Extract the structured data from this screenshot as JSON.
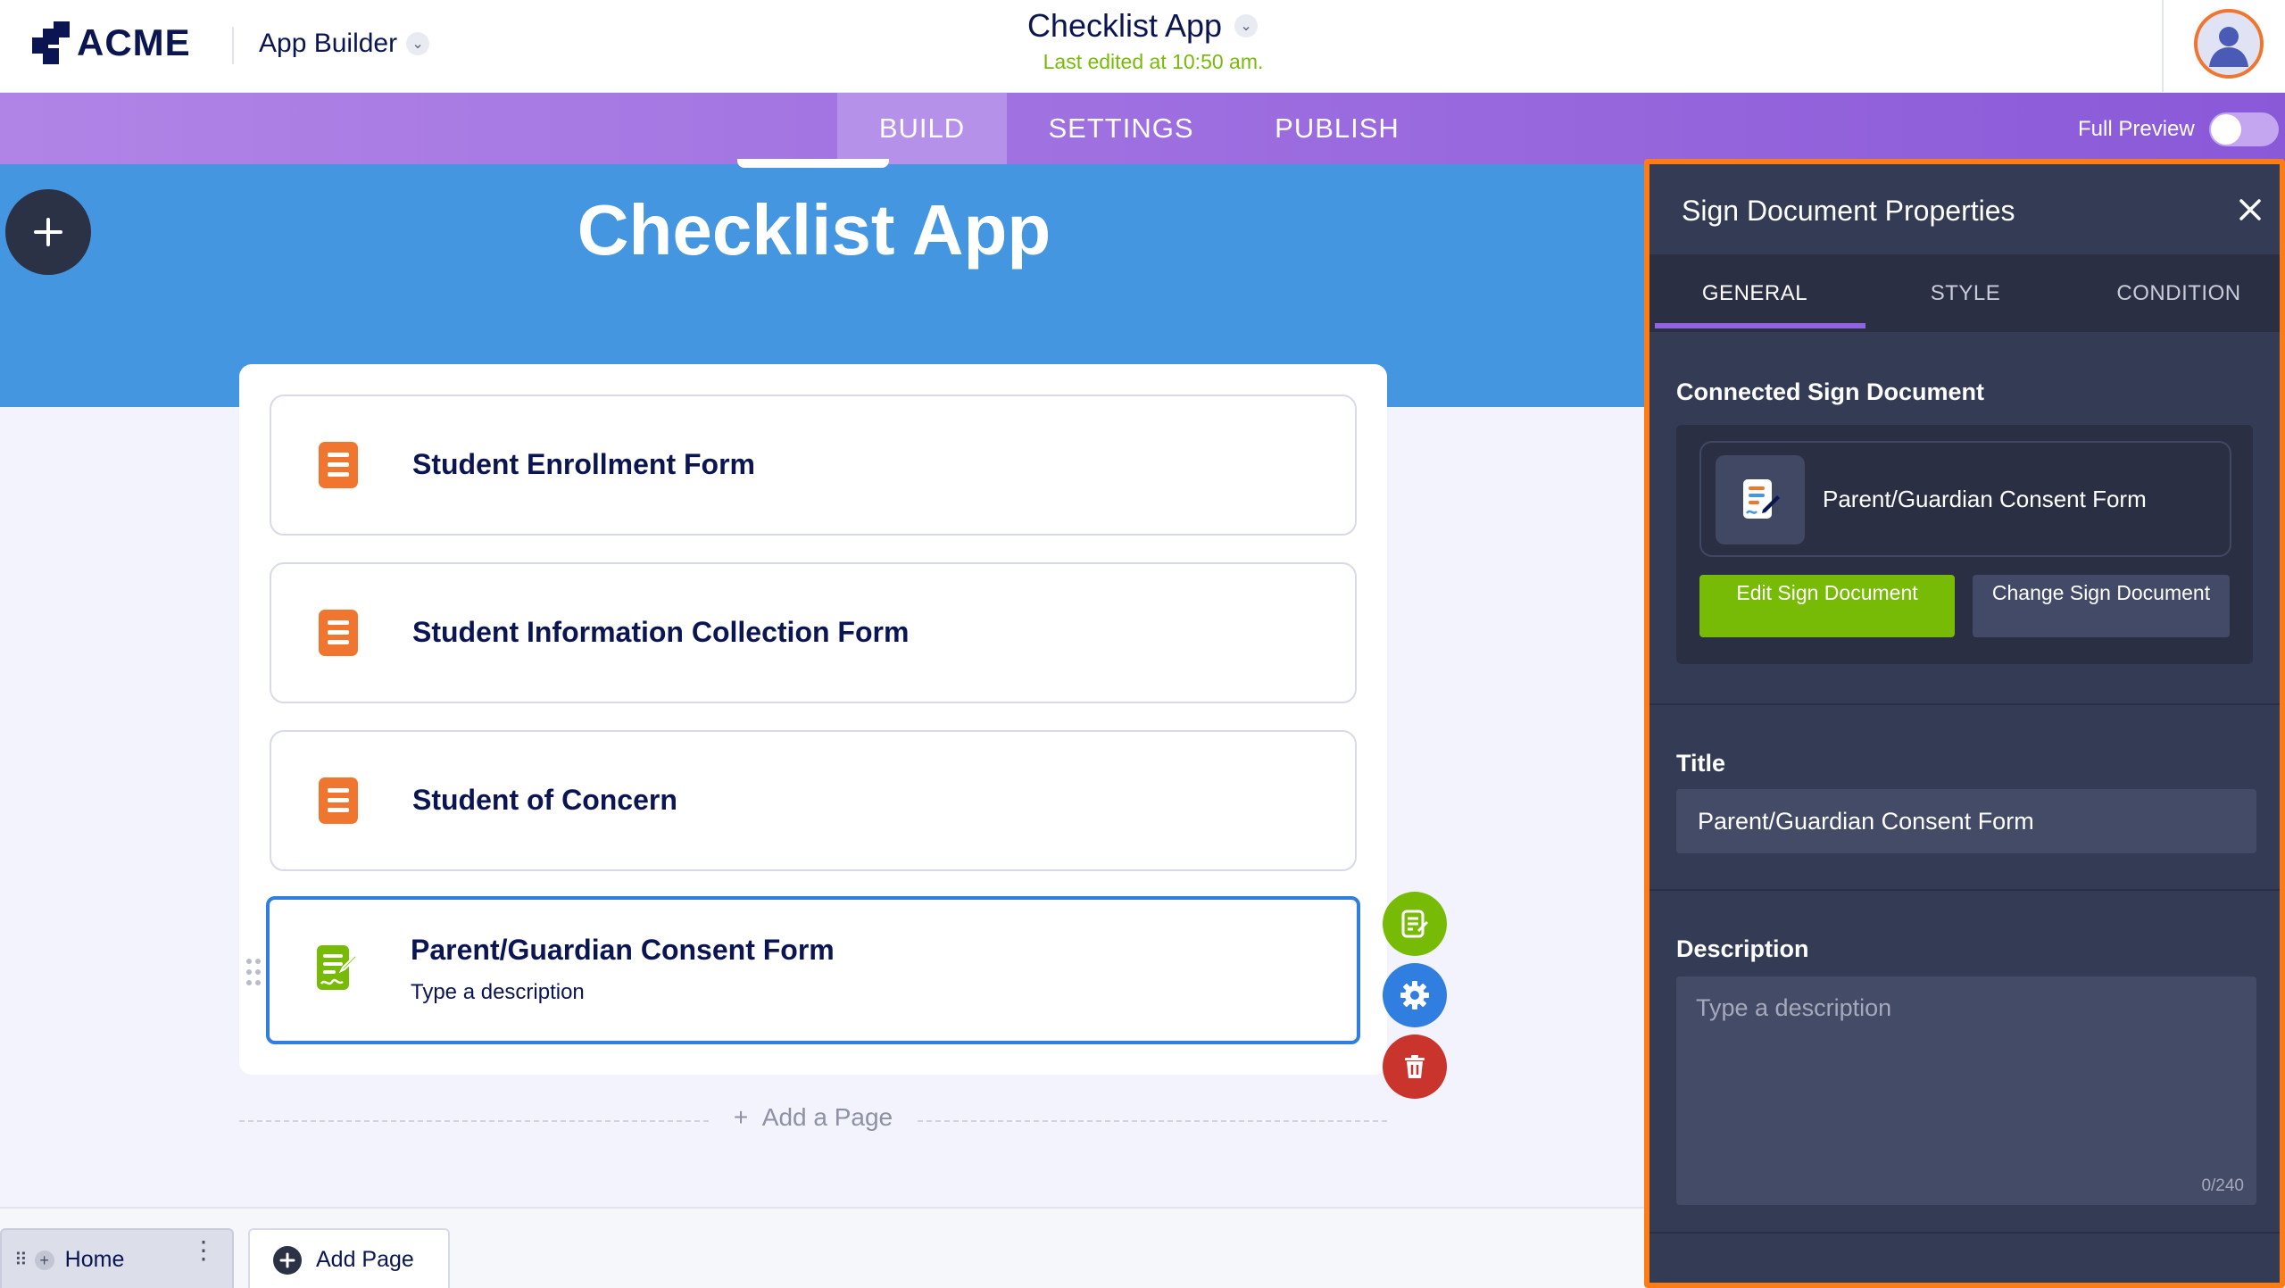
{
  "header": {
    "logo_text": "ACME",
    "app_builder_label": "App Builder",
    "app_title": "Checklist App",
    "last_edited": "Last edited at 10:50 am."
  },
  "topnav": {
    "tabs": [
      "BUILD",
      "SETTINGS",
      "PUBLISH"
    ],
    "active_tab": "BUILD",
    "full_preview_label": "Full Preview",
    "full_preview_on": false
  },
  "canvas": {
    "app_title": "Checklist App",
    "pages": [
      {
        "title": "Student Enrollment Form",
        "icon": "form-icon",
        "description": ""
      },
      {
        "title": "Student Information Collection Form",
        "icon": "form-icon",
        "description": ""
      },
      {
        "title": "Student of Concern",
        "icon": "form-icon",
        "description": ""
      },
      {
        "title": "Parent/Guardian Consent Form",
        "icon": "sign-document-icon",
        "description": "Type a description",
        "selected": true
      }
    ],
    "add_page_label": "Add a Page"
  },
  "bottombar": {
    "home_tab_label": "Home",
    "add_page_label": "Add Page"
  },
  "panel": {
    "title": "Sign Document Properties",
    "tabs": [
      "GENERAL",
      "STYLE",
      "CONDITION"
    ],
    "active_tab": "GENERAL",
    "connected_label": "Connected Sign Document",
    "document_name": "Parent/Guardian Consent Form",
    "edit_button": "Edit Sign Document",
    "change_button": "Change Sign Document",
    "title_label": "Title",
    "title_value": "Parent/Guardian Consent Form",
    "description_label": "Description",
    "description_placeholder": "Type a description",
    "description_count": "0/240"
  },
  "colors": {
    "brand_navy": "#0a1551",
    "nav_purple": "#9e6fe0",
    "canvas_blue": "#4596e0",
    "form_orange": "#f0762f",
    "sign_green": "#78bb07",
    "settings_blue": "#2f7ee0",
    "delete_red": "#c9342c",
    "panel_bg": "#343b54",
    "panel_highlight": "#ff7c14"
  }
}
